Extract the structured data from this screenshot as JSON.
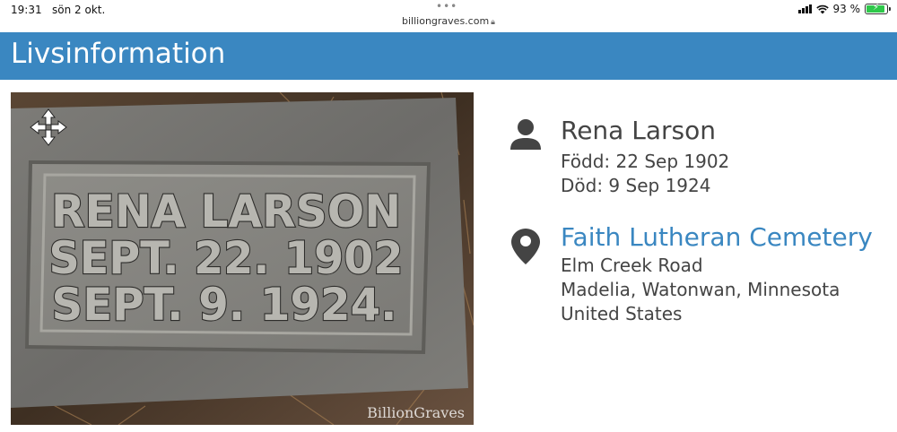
{
  "status_bar": {
    "time": "19:31",
    "date": "sön 2 okt.",
    "url": "billiongraves.com",
    "battery_percent": "93 %",
    "battery_level": 0.93,
    "icons": [
      "signal-icon",
      "wifi-icon",
      "battery-charging-icon",
      "lock-icon",
      "more-dots-icon"
    ]
  },
  "header": {
    "title": "Livsinformation",
    "color": "#3a87c1"
  },
  "photo": {
    "inscription_lines": [
      "RENA LARSON",
      "SEPT. 22. 1902",
      "SEPT. 9. 1924."
    ],
    "watermark": "BillionGraves",
    "icon": "move-arrows-icon"
  },
  "person": {
    "icon": "person-icon",
    "name": "Rena Larson",
    "born": "Född: 22 Sep 1902",
    "died": "Död: 9 Sep 1924"
  },
  "place": {
    "icon": "map-pin-icon",
    "cemetery": "Faith Lutheran Cemetery",
    "street": "Elm Creek Road",
    "region": "Madelia, Watonwan, Minnesota",
    "country": "United States",
    "link_color": "#3a87c1"
  }
}
